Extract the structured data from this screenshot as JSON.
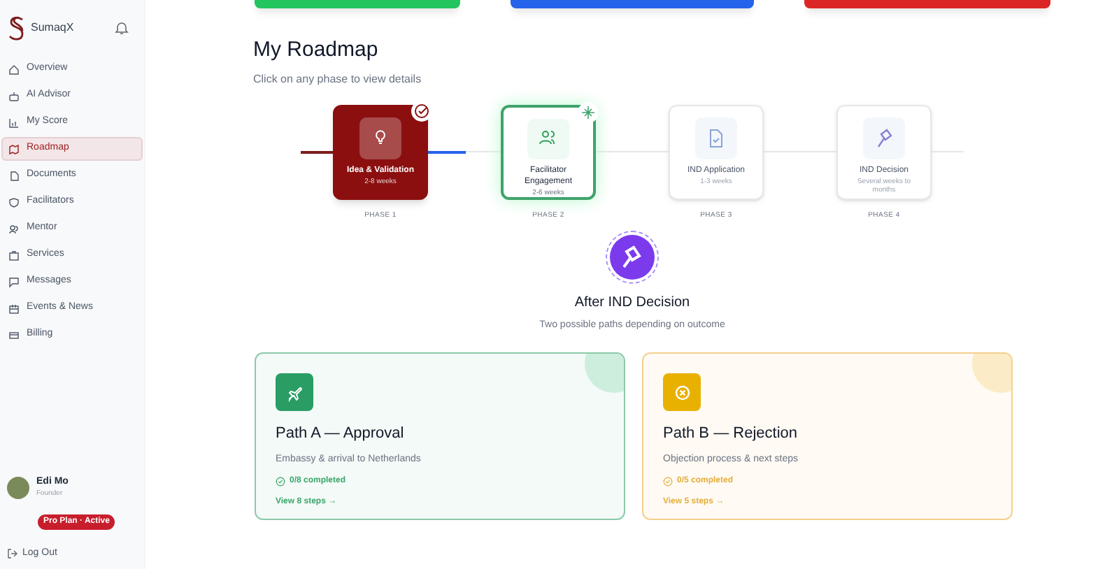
{
  "brand": "SumaqX",
  "nav": [
    {
      "label": "Overview",
      "selected": false
    },
    {
      "label": "AI Advisor",
      "selected": false
    },
    {
      "label": "My Score",
      "selected": false
    },
    {
      "label": "Roadmap",
      "selected": true
    },
    {
      "label": "Documents",
      "selected": false
    },
    {
      "label": "Facilitators",
      "selected": false
    },
    {
      "label": "Mentor",
      "selected": false
    },
    {
      "label": "Services",
      "selected": false
    },
    {
      "label": "Messages",
      "selected": false
    },
    {
      "label": "Events & News",
      "selected": false
    },
    {
      "label": "Billing",
      "selected": false
    }
  ],
  "user": {
    "name": "Edi Mo",
    "role": "Founder",
    "plan": "Pro Plan · Active"
  },
  "logout": "Log Out",
  "top_cards": [
    {
      "color": "#22c55e"
    },
    {
      "color": "#2563eb"
    },
    {
      "color": "#dc2626"
    }
  ],
  "roadmap": {
    "title": "My Roadmap",
    "subtitle": "Click on any phase to view details",
    "phases": [
      {
        "title": "Idea & Validation",
        "duration": "2-8 weeks",
        "label": "PHASE 1",
        "kind": "completed"
      },
      {
        "title": "Facilitator Engagement",
        "duration": "2-6 weeks",
        "label": "PHASE 2",
        "kind": "current"
      },
      {
        "title": "IND Application",
        "duration": "1-3 weeks",
        "label": "PHASE 3",
        "kind": "locked"
      },
      {
        "title": "IND Decision",
        "duration": "Several weeks to months",
        "label": "PHASE 4",
        "kind": "locked"
      }
    ]
  },
  "after": {
    "title": "After IND Decision",
    "subtitle": "Two possible paths depending on outcome",
    "paths": [
      {
        "kind": "approval",
        "title": "Path A — Approval",
        "description": "Embassy & arrival to Netherlands",
        "progress": "0/8 completed",
        "link": "View 8 steps →"
      },
      {
        "kind": "rejection",
        "title": "Path B — Rejection",
        "description": "Objection process & next steps",
        "progress": "0/5 completed",
        "link": "View 5 steps →"
      }
    ]
  }
}
